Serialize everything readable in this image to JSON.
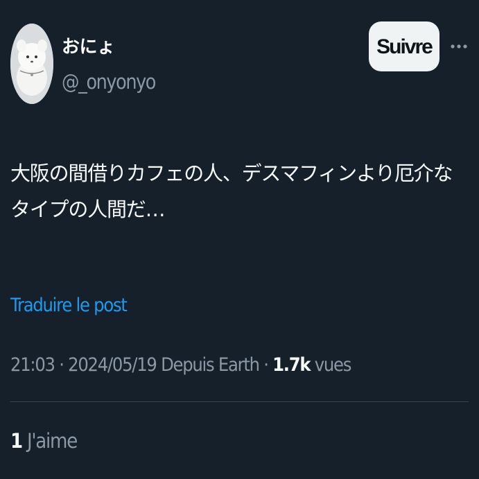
{
  "user": {
    "display_name": "おにょ",
    "handle": "@_onyonyo",
    "avatar_icon": "plush-toy-avatar"
  },
  "actions": {
    "follow_label": "Suivre",
    "more_icon": "more-horizontal-icon"
  },
  "tweet": {
    "text": "大阪の間借りカフェの人、デスマフィンより厄介なタイプの人間だ…",
    "translate_label": "Traduire le post"
  },
  "meta": {
    "time": "21:03",
    "date": "2024/05/19",
    "source": "Depuis Earth",
    "separator": "·",
    "views_count": "1.7k",
    "views_label": "vues"
  },
  "stats": {
    "likes_count": "1",
    "likes_label": "J'aime"
  },
  "colors": {
    "background": "#15202b",
    "text_primary": "#f7f9f9",
    "text_secondary": "#8b98a5",
    "link": "#1d9bf0",
    "button_bg": "#eff3f4",
    "divider": "#38444d"
  }
}
